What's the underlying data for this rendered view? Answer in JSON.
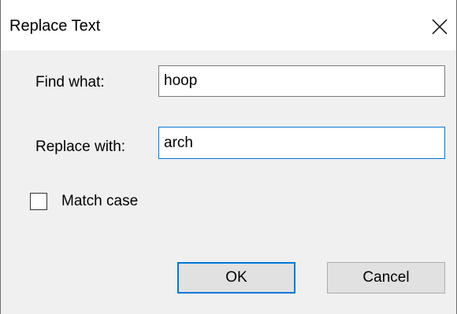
{
  "window": {
    "title": "Replace Text"
  },
  "form": {
    "find_label": "Find what:",
    "find_value": "hoop",
    "replace_label": "Replace with:",
    "replace_value": "arch",
    "match_case_label": "Match case",
    "match_case_checked": false
  },
  "buttons": {
    "ok_label": "OK",
    "cancel_label": "Cancel"
  },
  "icons": {
    "close": "close-icon"
  },
  "colors": {
    "client_background": "#f0f0f0",
    "focus_border": "#0078d7",
    "button_face": "#e1e1e1"
  }
}
